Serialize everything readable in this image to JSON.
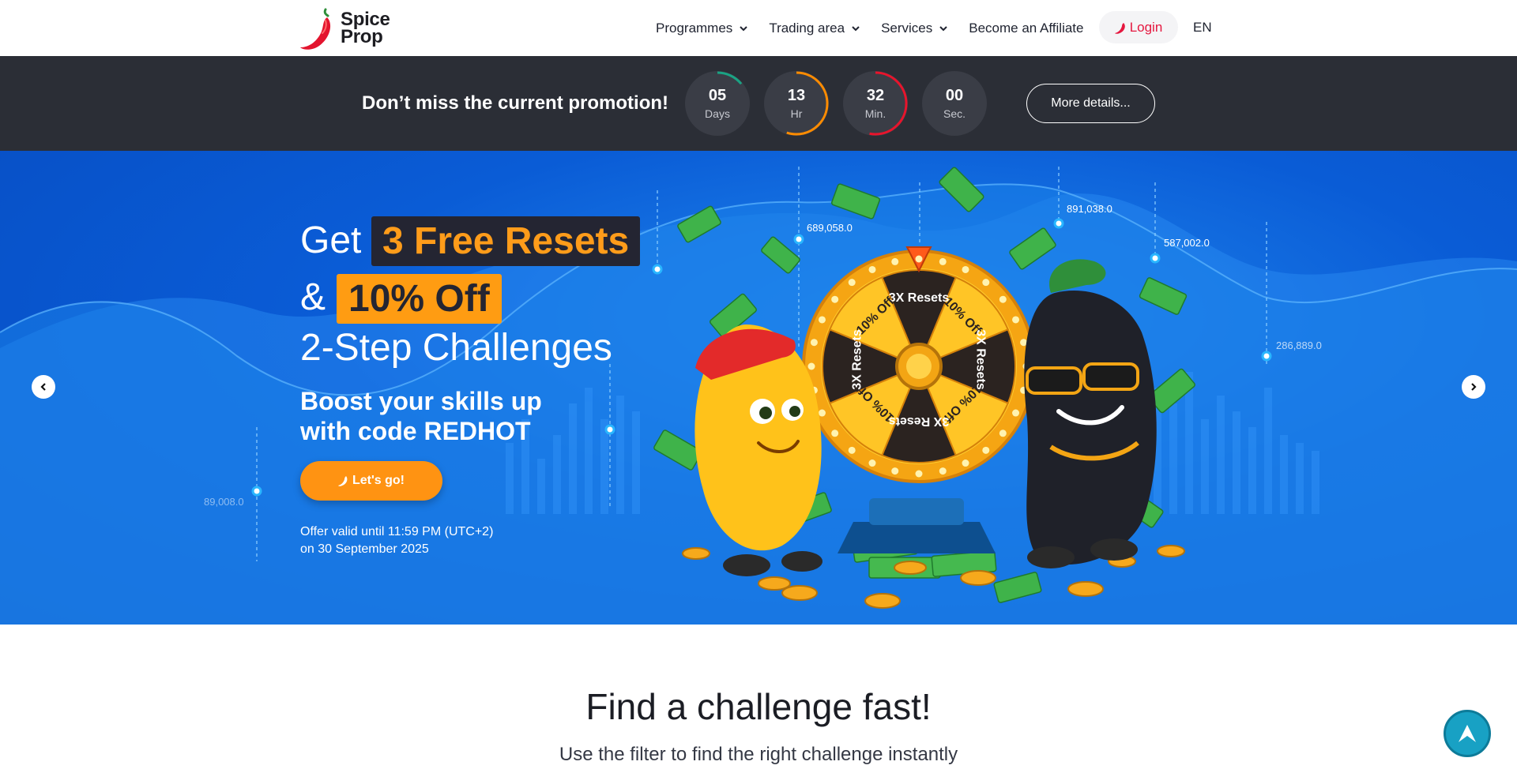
{
  "brand": {
    "name_line1": "Spice",
    "name_line2": "Prop"
  },
  "nav": {
    "items": [
      {
        "label": "Programmes",
        "has_dropdown": true
      },
      {
        "label": "Trading area",
        "has_dropdown": true
      },
      {
        "label": "Services",
        "has_dropdown": true
      },
      {
        "label": "Become an Affiliate",
        "has_dropdown": false
      }
    ],
    "login_label": "Login",
    "language": "EN"
  },
  "promo": {
    "title": "Don’t miss the current promotion!",
    "timers": [
      {
        "value": "05",
        "unit": "Days",
        "progress": 0.14,
        "color": "#1aa384"
      },
      {
        "value": "13",
        "unit": "Hr",
        "progress": 0.55,
        "color": "#ff8c00"
      },
      {
        "value": "32",
        "unit": "Min.",
        "progress": 0.53,
        "color": "#e8142c"
      },
      {
        "value": "00",
        "unit": "Sec.",
        "progress": 0.0,
        "color": "#2f7cf6"
      }
    ],
    "more_label": "More details..."
  },
  "hero": {
    "get": "Get",
    "highlight_1": "3 Free Resets",
    "amp": "&",
    "highlight_2": "10% Off",
    "line_3": "2-Step Challenges",
    "subtitle": "Boost your skills up with code REDHOT",
    "cta_label": "Let's go!",
    "offer_line1": "Offer valid until 11:59 PM (UTC+2)",
    "offer_line2": "on 30 September 2025",
    "chart_labels": [
      "89,008.0",
      "689,058.0",
      "891,038.0",
      "587,002.0",
      "286,889.0"
    ],
    "wheel_segments": [
      "3X Resets",
      "10% Off",
      "3X Resets",
      "10% Off",
      "3X Resets",
      "10% Off",
      "3X Resets",
      "10% Off"
    ]
  },
  "section": {
    "title": "Find a challenge fast!",
    "subtitle": "Use the filter to find the right challenge instantly"
  },
  "colors": {
    "accent_orange": "#ff9c12",
    "brand_red": "#e5173f",
    "promo_bg": "#2b2e36",
    "hero_blue": "#0a5cd6"
  }
}
